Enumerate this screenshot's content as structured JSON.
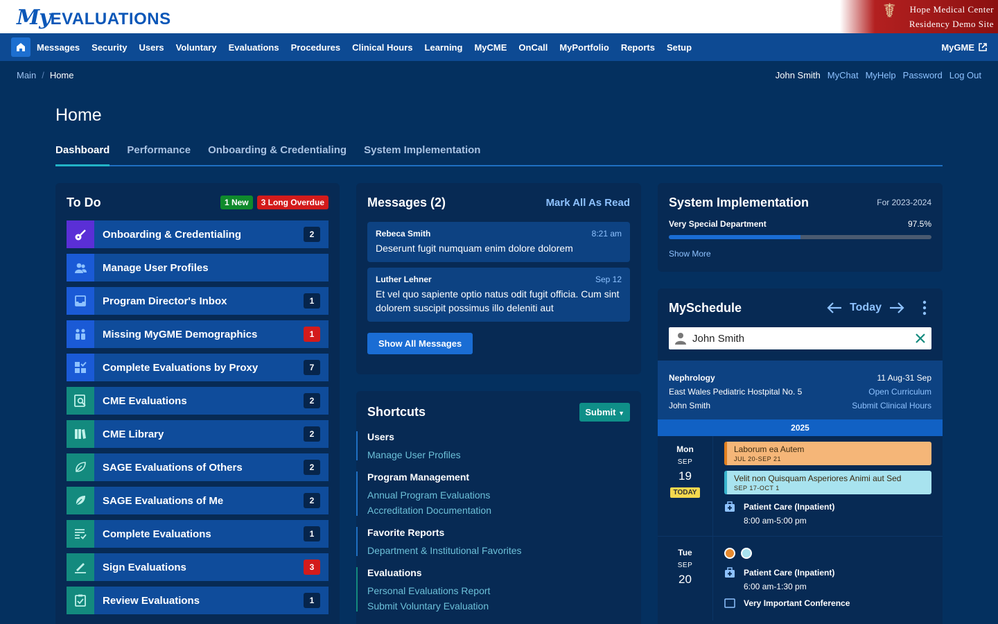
{
  "brand": {
    "logo_my": "My",
    "logo_rest": "EVALUATIONS",
    "org_line1": "Hope Medical Center",
    "org_line2": "Residency Demo Site"
  },
  "nav": {
    "items": [
      "Messages",
      "Security",
      "Users",
      "Voluntary",
      "Evaluations",
      "Procedures",
      "Clinical Hours",
      "Learning",
      "MyCME",
      "OnCall",
      "MyPortfolio",
      "Reports",
      "Setup"
    ],
    "right_label": "MyGME"
  },
  "breadcrumb": {
    "main": "Main",
    "sep": "/",
    "current": "Home"
  },
  "user_links": [
    "John Smith",
    "MyChat",
    "MyHelp",
    "Password",
    "Log Out"
  ],
  "page": {
    "title": "Home"
  },
  "tabs": [
    "Dashboard",
    "Performance",
    "Onboarding & Credentialing",
    "System Implementation"
  ],
  "todo": {
    "title": "To Do",
    "new_badge": "1 New",
    "overdue_badge": "3 Long Overdue",
    "items": [
      {
        "label": "Onboarding & Credentialing",
        "count": "2",
        "icon": "guitar-icon",
        "color": "#5a2fd6",
        "alert": false
      },
      {
        "label": "Manage User Profiles",
        "count": "",
        "icon": "users-icon",
        "color": "#1a5ad6",
        "alert": false
      },
      {
        "label": "Program Director's Inbox",
        "count": "1",
        "icon": "inbox-icon",
        "color": "#1a5ad6",
        "alert": false
      },
      {
        "label": "Missing MyGME Demographics",
        "count": "1",
        "icon": "people-icon",
        "color": "#1a5ad6",
        "alert": true
      },
      {
        "label": "Complete Evaluations by Proxy",
        "count": "7",
        "icon": "proxy-grid-icon",
        "color": "#1a5ad6",
        "alert": false
      },
      {
        "label": "CME Evaluations",
        "count": "2",
        "icon": "search-document-icon",
        "color": "#138a7e",
        "alert": false
      },
      {
        "label": "CME Library",
        "count": "2",
        "icon": "library-icon",
        "color": "#138a7e",
        "alert": false
      },
      {
        "label": "SAGE Evaluations of Others",
        "count": "2",
        "icon": "leaf-outline-icon",
        "color": "#138a7e",
        "alert": false
      },
      {
        "label": "SAGE Evaluations of Me",
        "count": "2",
        "icon": "leaf-icon",
        "color": "#138a7e",
        "alert": false
      },
      {
        "label": "Complete Evaluations",
        "count": "1",
        "icon": "checklist-icon",
        "color": "#138a7e",
        "alert": false
      },
      {
        "label": "Sign Evaluations",
        "count": "3",
        "icon": "signature-icon",
        "color": "#138a7e",
        "alert": true
      },
      {
        "label": "Review Evaluations",
        "count": "1",
        "icon": "clipboard-check-icon",
        "color": "#138a7e",
        "alert": false
      }
    ]
  },
  "messages": {
    "title": "Messages (2)",
    "mark_all": "Mark All As Read",
    "items": [
      {
        "from": "Rebeca Smith",
        "time": "8:21 am",
        "body": "Deserunt fugit numquam enim dolore dolorem"
      },
      {
        "from": "Luther Lehner",
        "time": "Sep 12",
        "body": "Et vel quo sapiente optio natus odit fugit officia. Cum sint dolorem suscipit possimus illo deleniti aut"
      }
    ],
    "show_all": "Show All Messages"
  },
  "shortcuts": {
    "title": "Shortcuts",
    "submit": "Submit",
    "groups": [
      {
        "title": "Users",
        "links": [
          "Manage User Profiles"
        ],
        "color": "#1f6fc2"
      },
      {
        "title": "Program Management",
        "links": [
          "Annual Program Evaluations",
          "Accreditation Documentation"
        ],
        "color": "#1f6fc2"
      },
      {
        "title": "Favorite Reports",
        "links": [
          "Department & Institutional Favorites"
        ],
        "color": "#1f6fc2"
      },
      {
        "title": "Evaluations",
        "links": [
          "Personal Evaluations Report",
          "Submit Voluntary Evaluation"
        ],
        "color": "#138a7e"
      }
    ]
  },
  "system_implementation": {
    "title": "System Implementation",
    "year": "For 2023-2024",
    "department": "Very Special Department",
    "percent_label": "97.5%",
    "progress_fraction": 0.5,
    "show_more": "Show More"
  },
  "myschedule": {
    "title": "MySchedule",
    "today": "Today",
    "search_value": "John Smith",
    "rotation": {
      "service": "Nephrology",
      "dates": "11 Aug-31 Sep",
      "site": "East Wales Pediatric Hostpital No. 5",
      "open_curriculum": "Open Curriculum",
      "person": "John Smith",
      "submit_hours": "Submit Clinical Hours"
    },
    "year": "2025",
    "days": [
      {
        "dow": "Mon",
        "month": "SEP",
        "day": "19",
        "today_label": "TODAY",
        "events": [
          {
            "title": "Laborum ea Autem",
            "dates": "JUL 20-SEP 21",
            "bg": "#f5b678",
            "border": "#e07f20"
          },
          {
            "title": "Velit non Quisquam Asperiores Animi aut Sed",
            "dates": "SEP 17-OCT 1",
            "bg": "#a8e3ef",
            "border": "#38b3cc"
          }
        ],
        "assignment": {
          "title": "Patient Care (Inpatient)",
          "time": "8:00 am-5:00 pm"
        }
      },
      {
        "dow": "Tue",
        "month": "SEP",
        "day": "20",
        "dots": [
          "#e88a2e",
          "#a8e3ef"
        ],
        "assignment": {
          "title": "Patient Care (Inpatient)",
          "time": "6:00 am-1:30 pm"
        },
        "extra": "Very Important Conference"
      }
    ]
  }
}
